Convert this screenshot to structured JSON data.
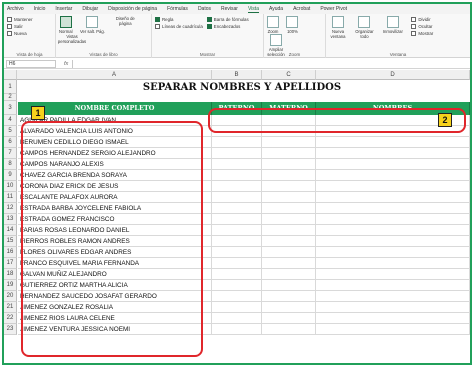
{
  "ribbon": {
    "tabs": [
      "Archivo",
      "Inicio",
      "Insertar",
      "Dibujar",
      "Disposición de página",
      "Fórmulas",
      "Datos",
      "Revisar",
      "Vista",
      "Ayuda",
      "Acrobat",
      "Power Pivot"
    ],
    "active_tab": "Vista",
    "groups": {
      "vistas_hoja": {
        "label": "Vista de hoja",
        "items": [
          "Mantener",
          "Salir",
          "Nueva"
        ]
      },
      "vistas_libro": {
        "label": "Vistas de libro",
        "normal": "Normal",
        "salto": "Ver salt. Pág.",
        "diseno": "Diseño de página",
        "personalizadas": "Vistas personalizadas"
      },
      "mostrar": {
        "label": "Mostrar",
        "regla": "Regla",
        "lineas": "Líneas de cuadrícula",
        "barra": "Barra de fórmulas",
        "encabezados": "Encabezados"
      },
      "zoom": {
        "label": "Zoom",
        "zoom": "Zoom",
        "cien": "100%",
        "ampliar": "Ampliar selección"
      },
      "ventana": {
        "label": "Ventana",
        "nueva": "Nueva ventana",
        "organizar": "Organizar todo",
        "inmovilizar": "Inmovilizar",
        "dividir": "Dividir",
        "ocultar": "Ocultar",
        "mostrar": "Mostrar"
      }
    }
  },
  "formula_bar": {
    "name_box": "H6",
    "fx": "fx"
  },
  "sheet": {
    "columns": [
      "A",
      "B",
      "C",
      "D"
    ],
    "title": "SEPARAR NOMBRES Y APELLIDOS",
    "headers": {
      "nombre_completo": "NOMBRE COMPLETO",
      "paterno": "PATERNO",
      "materno": "MATERNO",
      "nombres": "NOMBRES"
    },
    "row_numbers": [
      "1",
      "2",
      "3",
      "4",
      "5",
      "6",
      "7",
      "8",
      "9",
      "10",
      "11",
      "12",
      "13",
      "14",
      "15",
      "16",
      "17",
      "18",
      "19",
      "20",
      "21",
      "22",
      "23"
    ],
    "names": [
      "AGUILAR PADILLA EDGAR IVAN",
      "ALVARADO VALENCIA LUIS ANTONIO",
      "BERUMEN CEDILLO DIEGO ISMAEL",
      "CAMPOS HERNANDEZ SERGIO ALEJANDRO",
      "CAMPOS NARANJO ALEXIS",
      "CHAVEZ GARCIA BRENDA SORAYA",
      "CORONA DIAZ ERICK DE JESUS",
      "ESCALANTE PALAFOX AURORA",
      "ESTRADA BARBA JOYCELENE FABIOLA",
      "ESTRADA GOMEZ FRANCISCO",
      "FARIAS ROSAS LEONARDO DANIEL",
      "FIERROS ROBLES RAMON ANDRES",
      "FLORES OLIVARES EDGAR ANDRES",
      "FRANCO ESQUIVEL MARIA FERNANDA",
      "GALVAN MUÑIZ ALEJANDRO",
      "GUTIERREZ ORTIZ MARTHA ALICIA",
      "HERNANDEZ SAUCEDO JOSAFAT GERARDO",
      "JIMENEZ GONZALEZ ROSALIA",
      "JIMENEZ RIOS LAURA CELENE",
      "JIMENEZ VENTURA JESSICA NOEMI"
    ]
  },
  "callouts": {
    "one": "1",
    "two": "2"
  },
  "colors": {
    "header_green": "#21a05a",
    "frame_green": "#21a05a",
    "callout_red": "#e0262b",
    "callout_yellow": "#f6d21c"
  }
}
